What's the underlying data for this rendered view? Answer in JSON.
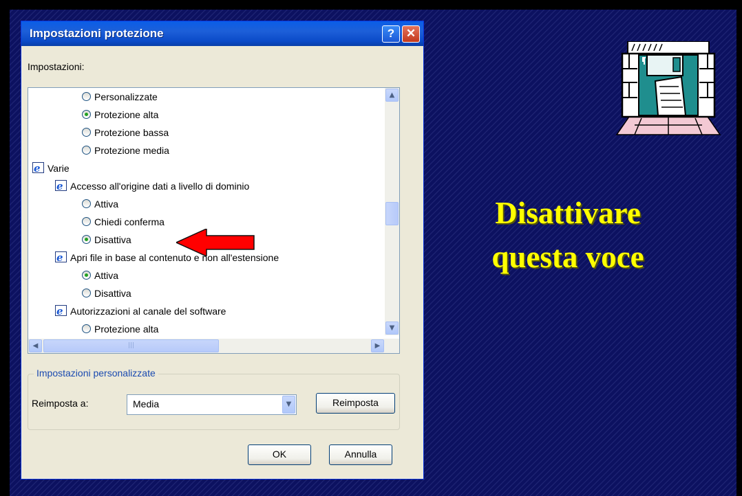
{
  "dialog": {
    "title": "Impostazioni protezione",
    "help_label": "?",
    "close_label": "✕",
    "settings_label": "Impostazioni:",
    "tree": [
      {
        "type": "radio",
        "label": "Personalizzate",
        "checked": false,
        "level": 2
      },
      {
        "type": "radio",
        "label": "Protezione alta",
        "checked": true,
        "level": 2
      },
      {
        "type": "radio",
        "label": "Protezione bassa",
        "checked": false,
        "level": 2
      },
      {
        "type": "radio",
        "label": "Protezione media",
        "checked": false,
        "level": 2
      },
      {
        "type": "group",
        "label": "Varie",
        "level": 0
      },
      {
        "type": "group",
        "label": "Accesso all'origine dati a livello di dominio",
        "level": 1
      },
      {
        "type": "radio",
        "label": "Attiva",
        "checked": false,
        "level": 2
      },
      {
        "type": "radio",
        "label": "Chiedi conferma",
        "checked": false,
        "level": 2
      },
      {
        "type": "radio",
        "label": "Disattiva",
        "checked": true,
        "level": 2
      },
      {
        "type": "group",
        "label": "Apri file in base al contenuto e non all'estensione",
        "level": 1
      },
      {
        "type": "radio",
        "label": "Attiva",
        "checked": true,
        "level": 2
      },
      {
        "type": "radio",
        "label": "Disattiva",
        "checked": false,
        "level": 2
      },
      {
        "type": "group",
        "label": "Autorizzazioni al canale del software",
        "level": 1
      },
      {
        "type": "radio",
        "label": "Protezione alta",
        "checked": false,
        "level": 2
      }
    ],
    "custom_group_label": "Impostazioni personalizzate",
    "reset_to_label": "Reimposta a:",
    "reset_value": "Media",
    "reset_button": "Reimposta",
    "ok_button": "OK",
    "cancel_button": "Annulla"
  },
  "headline": {
    "line1": "Disattivare",
    "line2": "questa voce"
  },
  "colors": {
    "headline": "#ffff00",
    "arrow": "#ff0000",
    "background": "#0c1160"
  },
  "icons": {
    "clipart": "floppy-disk-castle-gate-icon",
    "tree_group": "internet-explorer-icon"
  }
}
